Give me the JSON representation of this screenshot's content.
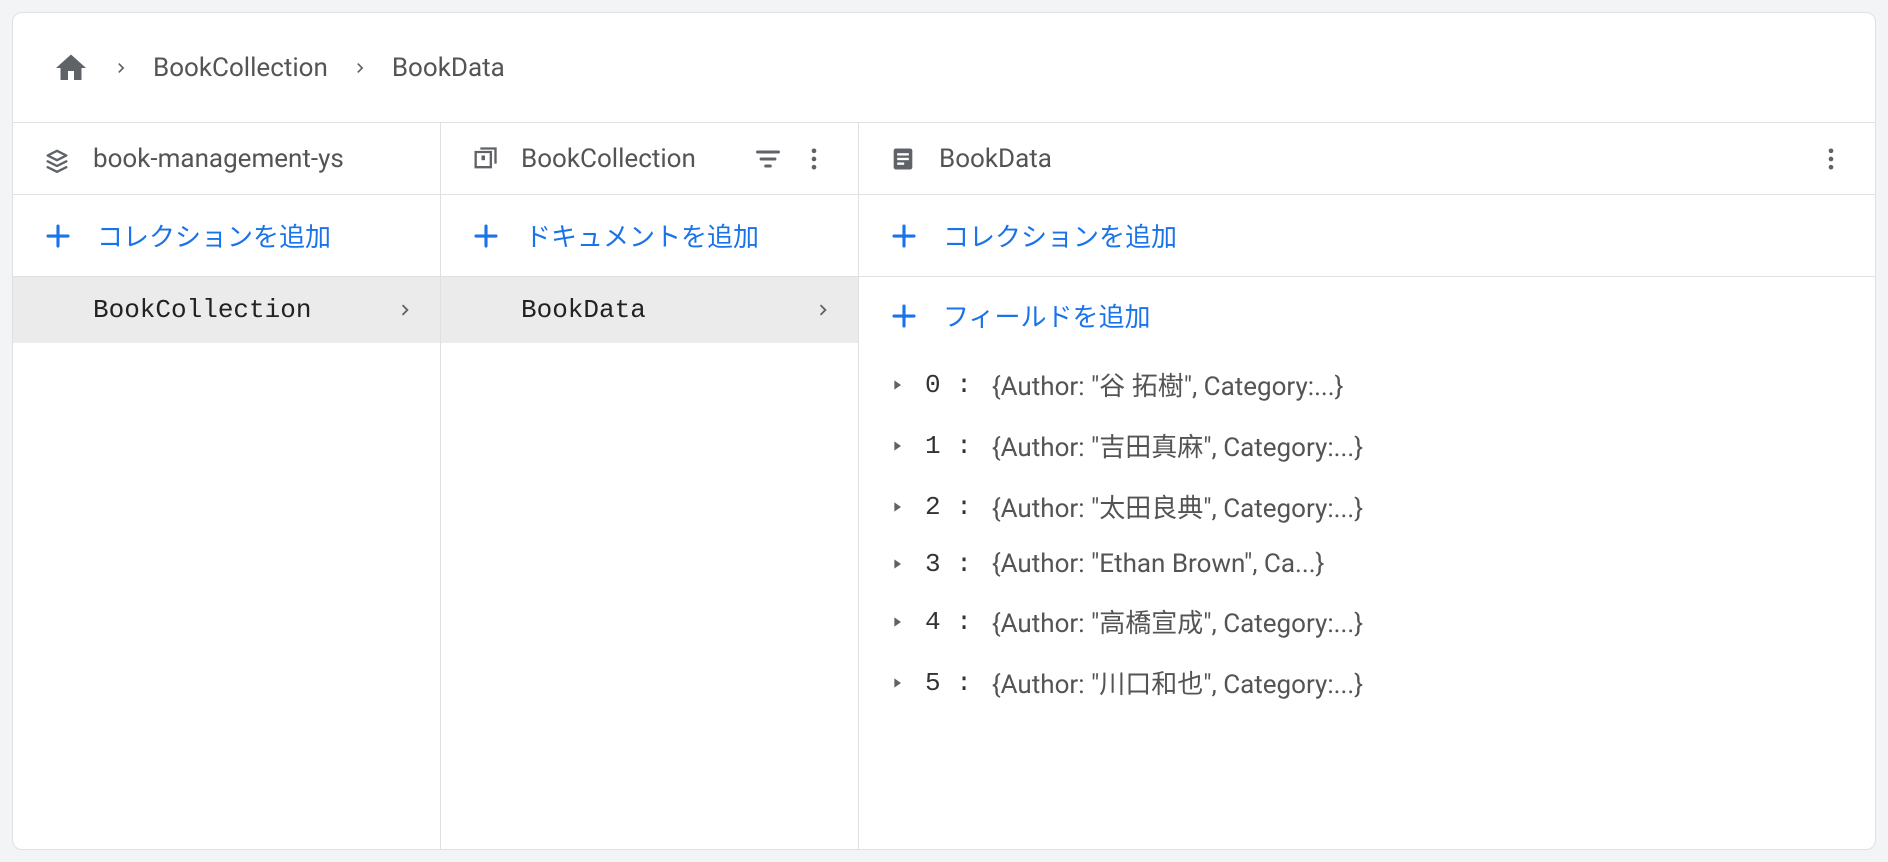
{
  "breadcrumb": {
    "items": [
      "BookCollection",
      "BookData"
    ]
  },
  "col0": {
    "title": "book-management-ys",
    "add_label": "コレクションを追加",
    "items": [
      {
        "label": "BookCollection",
        "selected": true
      }
    ]
  },
  "col1": {
    "title": "BookCollection",
    "add_label": "ドキュメントを追加",
    "items": [
      {
        "label": "BookData",
        "selected": true
      }
    ]
  },
  "col2": {
    "title": "BookData",
    "add_collection_label": "コレクションを追加",
    "add_field_label": "フィールドを追加",
    "fields": [
      {
        "index": "0",
        "preview": "{Author: \"谷 拓樹\", Category:...}"
      },
      {
        "index": "1",
        "preview": "{Author: \"吉田真麻\", Category:...}"
      },
      {
        "index": "2",
        "preview": "{Author: \"太田良典\", Category:...}"
      },
      {
        "index": "3",
        "preview": "{Author: \"Ethan Brown\", Ca...}"
      },
      {
        "index": "4",
        "preview": "{Author: \"高橋宣成\", Category:...}"
      },
      {
        "index": "5",
        "preview": "{Author: \"川口和也\", Category:...}"
      }
    ]
  }
}
